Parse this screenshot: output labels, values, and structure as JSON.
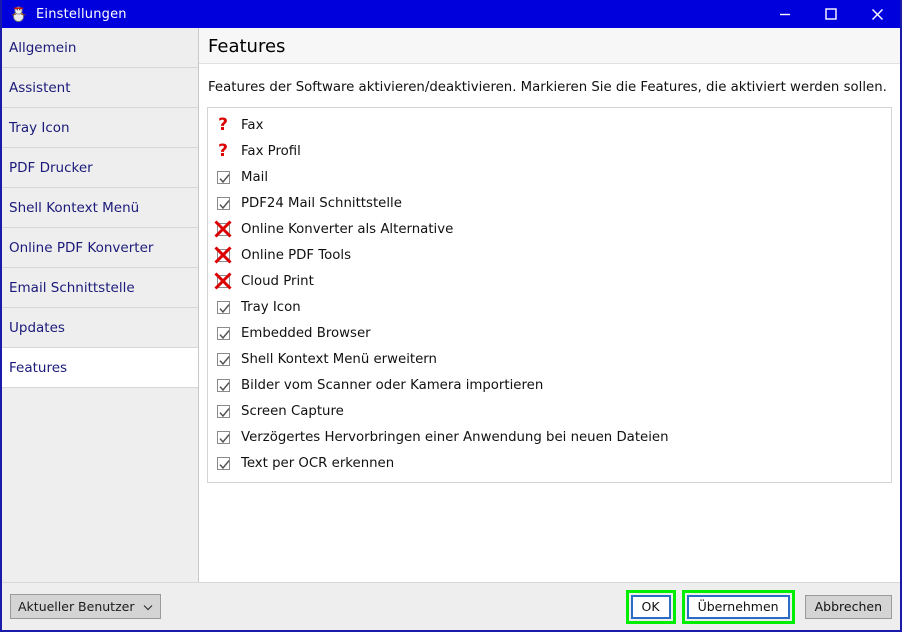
{
  "window": {
    "title": "Einstellungen",
    "icon": "app-mascot-icon",
    "title_bar_color": "#0000dd",
    "border_color": "#1a1aaa",
    "controls": {
      "minimize": "minimize-icon",
      "maximize": "maximize-icon",
      "close": "close-icon"
    }
  },
  "sidebar": {
    "items": [
      {
        "label": "Allgemein",
        "selected": false
      },
      {
        "label": "Assistent",
        "selected": false
      },
      {
        "label": "Tray Icon",
        "selected": false
      },
      {
        "label": "PDF Drucker",
        "selected": false
      },
      {
        "label": "Shell Kontext Menü",
        "selected": false
      },
      {
        "label": "Online PDF Konverter",
        "selected": false
      },
      {
        "label": "Email Schnittstelle",
        "selected": false
      },
      {
        "label": "Updates",
        "selected": false
      },
      {
        "label": "Features",
        "selected": true
      }
    ]
  },
  "content": {
    "title": "Features",
    "description": "Features der Software aktivieren/deaktivieren. Markieren Sie die Features, die aktiviert werden sollen.",
    "features": [
      {
        "label": "Fax",
        "state": "question"
      },
      {
        "label": "Fax Profil",
        "state": "question"
      },
      {
        "label": "Mail",
        "state": "checked"
      },
      {
        "label": "PDF24 Mail Schnittstelle",
        "state": "checked"
      },
      {
        "label": "Online Konverter als Alternative",
        "state": "crossed"
      },
      {
        "label": "Online PDF Tools",
        "state": "crossed"
      },
      {
        "label": "Cloud Print",
        "state": "crossed"
      },
      {
        "label": "Tray Icon",
        "state": "checked"
      },
      {
        "label": "Embedded Browser",
        "state": "checked"
      },
      {
        "label": "Shell Kontext Menü erweitern",
        "state": "checked"
      },
      {
        "label": "Bilder vom Scanner oder Kamera importieren",
        "state": "checked"
      },
      {
        "label": "Screen Capture",
        "state": "checked"
      },
      {
        "label": "Verzögertes Hervorbringen einer Anwendung bei neuen Dateien",
        "state": "checked"
      },
      {
        "label": "Text per OCR erkennen",
        "state": "checked"
      }
    ]
  },
  "footer": {
    "user_scope": {
      "value": "Aktueller Benutzer",
      "chevron": "chevron-down-icon"
    },
    "ok_label": "OK",
    "apply_label": "Übernehmen",
    "cancel_label": "Abbrechen"
  },
  "annotation": {
    "highlight_color": "#00ee00",
    "focus_border_color": "#2b6cc4"
  }
}
